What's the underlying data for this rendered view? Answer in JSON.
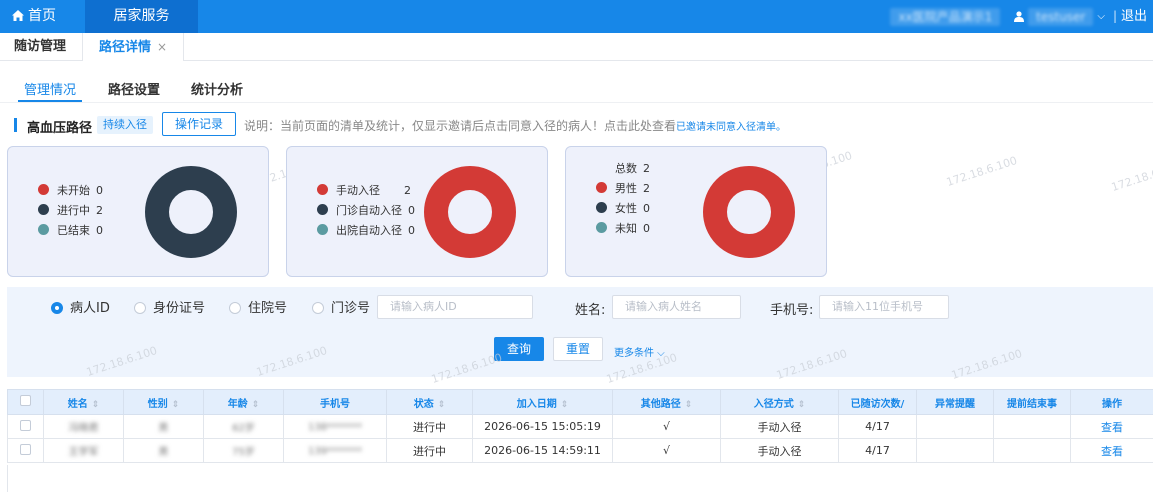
{
  "topbar": {
    "home_label": "首页",
    "service_label": "居家服务",
    "org_name": "xx医院产品演示1",
    "user_name": "testuser",
    "separator": "|",
    "logout_label": "退出",
    "icons": [
      "home-icon",
      "user-icon",
      "chevron-down-icon"
    ]
  },
  "tabs": [
    {
      "label": "随访管理",
      "active": false
    },
    {
      "label": "路径详情",
      "active": true,
      "close": "×"
    }
  ],
  "subtabs": [
    "管理情况",
    "路径设置",
    "统计分析"
  ],
  "path": {
    "title": "高血压路径",
    "tag": "持续入径",
    "record_button": "操作记录",
    "description": "说明：当前页面的清单及统计，仅显示邀请后点击同意入径的病人！点击此处查看",
    "link": "已邀请未同意入径清单。"
  },
  "watermark": "172.18.6.100",
  "stats_cards": [
    {
      "items": [
        {
          "label": "未开始",
          "value": "0",
          "color": "#d33a36"
        },
        {
          "label": "进行中",
          "value": "2",
          "color": "#2d3e4e"
        },
        {
          "label": "已结束",
          "value": "0",
          "color": "#5b9ba1"
        }
      ]
    },
    {
      "items": [
        {
          "label": "手动入径",
          "value": "2",
          "color": "#d33a36"
        },
        {
          "label": "门诊自动入径",
          "value": "0",
          "color": "#2d3e4e"
        },
        {
          "label": "出院自动入径",
          "value": "0",
          "color": "#5b9ba1"
        }
      ]
    },
    {
      "total_label": "总数",
      "total_value": "2",
      "items": [
        {
          "label": "男性",
          "value": "2",
          "color": "#d33a36"
        },
        {
          "label": "女性",
          "value": "0",
          "color": "#2d3e4e"
        },
        {
          "label": "未知",
          "value": "0",
          "color": "#5b9ba1"
        }
      ]
    }
  ],
  "search": {
    "radios": [
      {
        "label": "病人ID",
        "selected": true
      },
      {
        "label": "身份证号",
        "selected": false
      },
      {
        "label": "住院号",
        "selected": false
      },
      {
        "label": "门诊号",
        "selected": false
      }
    ],
    "id_placeholder": "请输入病人ID",
    "name_label": "姓名:",
    "name_placeholder": "请输入病人姓名",
    "phone_label": "手机号:",
    "phone_placeholder": "请输入11位手机号",
    "query_button": "查询",
    "reset_button": "重置",
    "more_conditions": "更多条件 ⌵"
  },
  "table": {
    "columns": [
      "姓名",
      "性别",
      "年龄",
      "手机号",
      "状态",
      "加入日期",
      "其他路径",
      "入径方式",
      "已随访次数/",
      "异常提醒",
      "提前结束事",
      "操作"
    ],
    "rows": [
      {
        "name": "冯晓君",
        "gender": "男",
        "age": "62岁",
        "phone": "138*******",
        "status": "进行中",
        "join_date": "2026-06-15 15:05:19",
        "other_path": "√",
        "entry_method": "手动入径",
        "visits": "4/17",
        "alert": "",
        "early_end": "",
        "action": "查看"
      },
      {
        "name": "王学军",
        "gender": "男",
        "age": "75岁",
        "phone": "139*******",
        "status": "进行中",
        "join_date": "2026-06-15 14:59:11",
        "other_path": "√",
        "entry_method": "手动入径",
        "visits": "4/17",
        "alert": "",
        "early_end": "",
        "action": "查看"
      }
    ]
  }
}
